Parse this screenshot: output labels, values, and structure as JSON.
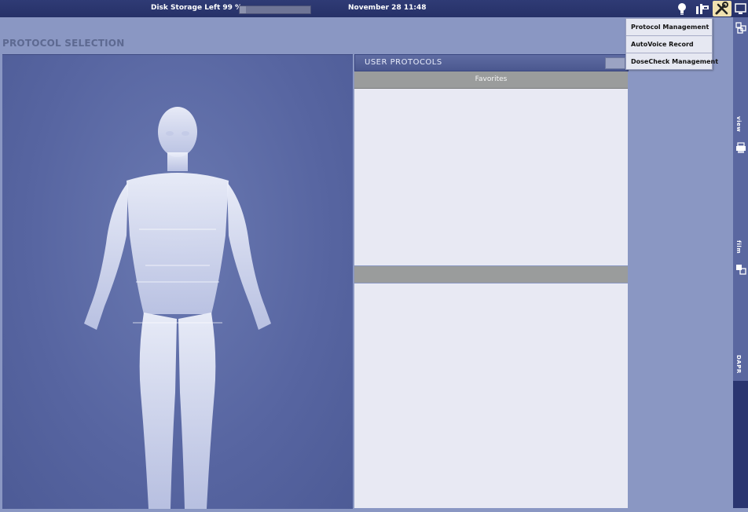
{
  "topbar": {
    "disk_label": "Disk Storage Left 99 %",
    "disk_percent": 99,
    "datetime": "November 28 11:48",
    "icons": [
      "lightbulb-icon",
      "tools-icon",
      "wrench-icon",
      "monitor-icon"
    ]
  },
  "page": {
    "title": "PROTOCOL SELECTION"
  },
  "user_protocols": {
    "title": "USER  PROTOCOLS",
    "favorites_header": "Favorites"
  },
  "menu": {
    "items": [
      "Protocol Management",
      "AutoVoice Record",
      "DoseCheck Management"
    ]
  },
  "rail": {
    "labels": [
      "view",
      "film",
      "DAPR"
    ],
    "icons": [
      "grid-icon",
      "printer-icon",
      "layers-icon"
    ]
  },
  "colors": {
    "topbar": "#2a346d",
    "background": "#8a97c3",
    "panel": "#5765a1",
    "list_bg": "#e8e9f3",
    "header_gray": "#9a9c9c"
  }
}
